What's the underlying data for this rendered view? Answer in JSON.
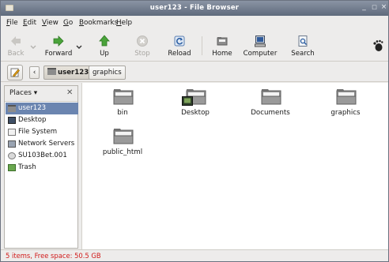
{
  "window": {
    "title": "user123 - File Browser",
    "controls": [
      "_",
      "□",
      "×"
    ]
  },
  "menu": {
    "items": [
      {
        "label": "File",
        "mnemonic": "F"
      },
      {
        "label": "Edit",
        "mnemonic": "E"
      },
      {
        "label": "View",
        "mnemonic": "V"
      },
      {
        "label": "Go",
        "mnemonic": "G"
      },
      {
        "label": "Bookmarks",
        "mnemonic": "B"
      },
      {
        "label": "Help",
        "mnemonic": "H"
      }
    ]
  },
  "toolbar": {
    "back": "Back",
    "forward": "Forward",
    "up": "Up",
    "stop": "Stop",
    "reload": "Reload",
    "home": "Home",
    "computer": "Computer",
    "search": "Search"
  },
  "location": {
    "crumbs": [
      "user123",
      "graphics"
    ]
  },
  "sidebar": {
    "selector": "Places",
    "items": [
      {
        "label": "user123",
        "icon": "home-folder-icon"
      },
      {
        "label": "Desktop",
        "icon": "desktop-icon"
      },
      {
        "label": "File System",
        "icon": "drive-icon"
      },
      {
        "label": "Network Servers",
        "icon": "network-icon"
      },
      {
        "label": "SU103Bet.001",
        "icon": "disc-icon"
      },
      {
        "label": "Trash",
        "icon": "trash-icon"
      }
    ]
  },
  "files": [
    {
      "name": "bin"
    },
    {
      "name": "Desktop"
    },
    {
      "name": "Documents"
    },
    {
      "name": "graphics"
    },
    {
      "name": "public_html"
    }
  ],
  "status": {
    "text": "5 items, Free space: 50.5 GB"
  },
  "colors": {
    "selection": "#6b85b0",
    "status_text": "#d11b1b",
    "folder": "#8c8c8c"
  }
}
